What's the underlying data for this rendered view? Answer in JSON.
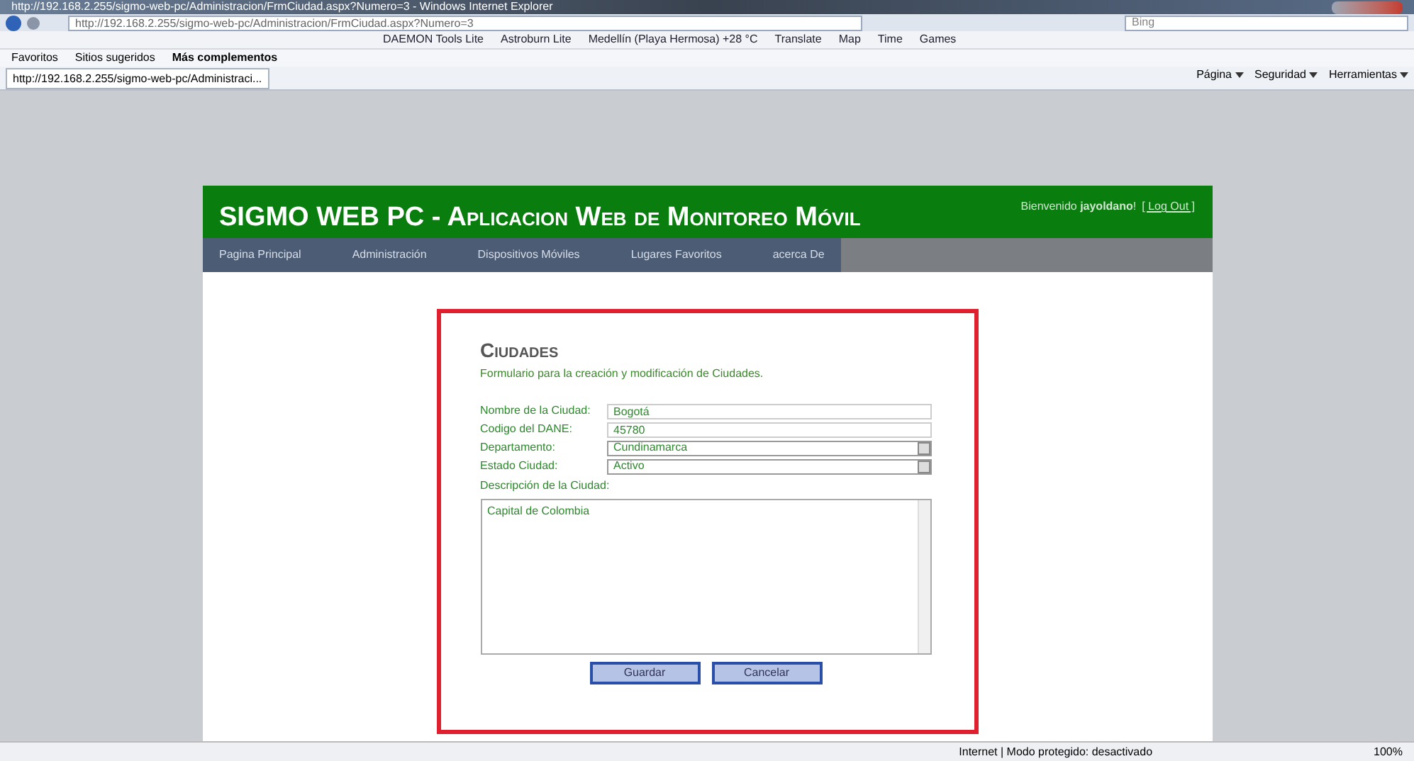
{
  "window": {
    "title": "http://192.168.2.255/sigmo-web-pc/Administracion/FrmCiudad.aspx?Numero=3 - Windows Internet Explorer"
  },
  "address_bar": {
    "value": "http://192.168.2.255/sigmo-web-pc/Administracion/FrmCiudad.aspx?Numero=3"
  },
  "search": {
    "placeholder": "Bing"
  },
  "toolbar": {
    "items": [
      "DAEMON Tools Lite",
      "Astroburn Lite",
      "Medellín (Playa Hermosa) +28 °C",
      "Translate",
      "Map",
      "Time",
      "Games"
    ]
  },
  "favorites_bar": {
    "items": [
      "Favoritos",
      "Sitios sugeridos",
      "Más complementos"
    ]
  },
  "tabs": [
    {
      "label": "http://192.168.2.255/sigmo-web-pc/Administraci...",
      "selected": true
    }
  ],
  "command_bar": {
    "items": [
      "Página",
      "Seguridad",
      "Herramientas"
    ]
  },
  "page": {
    "title": "SIGMO WEB PC - Aplicacion Web de Monitoreo Móvil",
    "welcome": "Bienvenido **jayoldano**!",
    "logout": "[ Log Out ]",
    "nav": [
      "Pagina Principal",
      "Administración",
      "Dispositivos Móviles",
      "Lugares Favoritos",
      "acerca De"
    ],
    "form": {
      "title": "Ciudades",
      "subtitle": "Formulario para la creación y modificación de Ciudades.",
      "fields": [
        {
          "kind": "text",
          "label": "Nombre de la Ciudad:",
          "value": "Bogotá"
        },
        {
          "kind": "text",
          "label": "Codigo del DANE:",
          "value": "45780"
        },
        {
          "kind": "select",
          "label": "Departamento:",
          "value": "Cundinamarca"
        },
        {
          "kind": "select",
          "label": "Estado Ciudad:",
          "value": "Activo"
        }
      ],
      "description": {
        "label": "Descripción de la Ciudad:",
        "value": "Capital de Colombia"
      },
      "buttons": [
        "Guardar",
        "Cancelar"
      ]
    }
  },
  "status_bar": {
    "zone": "Internet | Modo protegido: desactivado",
    "zoom": "100%"
  }
}
